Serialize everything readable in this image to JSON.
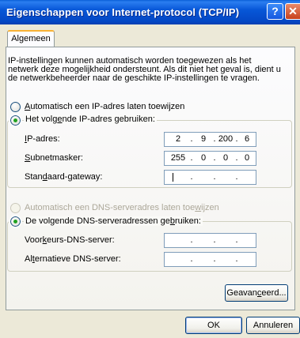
{
  "window": {
    "title": "Eigenschappen voor Internet-protocol (TCP/IP)",
    "help_label": "?",
    "close_label": "✕"
  },
  "tab": {
    "label": "Algemeen"
  },
  "description": "IP-instellingen kunnen automatisch worden toegewezen als het netwerk deze mogelijkheid ondersteunt. Als dit niet het geval is, dient u de netwerkbeheerder naar de geschikte IP-instellingen te vragen.",
  "ip": {
    "auto_option": {
      "label_prefix": "",
      "accel": "A",
      "label_suffix": "utomatisch een IP-adres laten toewijzen",
      "selected": false
    },
    "manual_option": {
      "label_prefix": "Het volg",
      "accel": "e",
      "label_suffix": "nde IP-adres gebruiken:",
      "selected": true
    },
    "fields": [
      {
        "label_prefix": "",
        "accel": "I",
        "label_suffix": "P-adres:",
        "value": [
          "2",
          "9",
          "200",
          "6"
        ]
      },
      {
        "label_prefix": "",
        "accel": "S",
        "label_suffix": "ubnetmasker:",
        "value": [
          "255",
          "0",
          "0",
          "0"
        ]
      },
      {
        "label_prefix": "Stan",
        "accel": "d",
        "label_suffix": "aard-gateway:",
        "value": [
          "",
          "",
          "",
          ""
        ]
      }
    ]
  },
  "dns": {
    "auto_option": {
      "label_prefix": "Automatisch een DNS-serveradres laten toe",
      "accel": "w",
      "label_suffix": "ijzen",
      "selected": false,
      "disabled": true
    },
    "manual_option": {
      "label_prefix": "De volgende DNS-serveradressen ge",
      "accel": "b",
      "label_suffix": "ruiken:",
      "selected": true
    },
    "fields": [
      {
        "label_prefix": "Voor",
        "accel": "k",
        "label_suffix": "eurs-DNS-server:",
        "value": [
          "",
          "",
          "",
          ""
        ]
      },
      {
        "label_prefix": "Al",
        "accel": "t",
        "label_suffix": "ernatieve DNS-server:",
        "value": [
          "",
          "",
          "",
          ""
        ]
      }
    ]
  },
  "buttons": {
    "advanced": {
      "label_prefix": "Geavan",
      "accel": "c",
      "label_suffix": "eerd..."
    },
    "ok": "OK",
    "cancel": "Annuleren"
  },
  "colors": {
    "titlebar": "#0757d8",
    "dialog_bg": "#ece9d8",
    "radio_dot": "#21a121",
    "tab_accent": "#f9b233"
  }
}
